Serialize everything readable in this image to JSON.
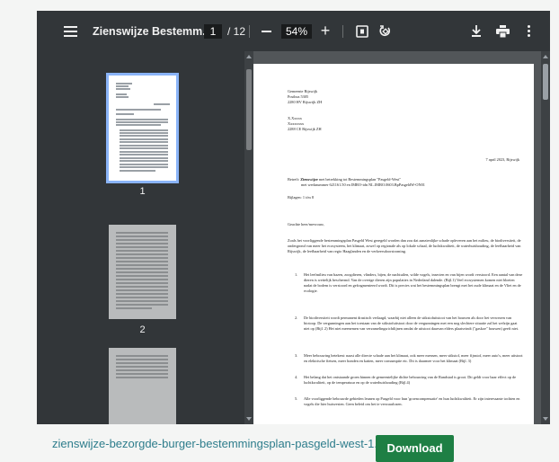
{
  "toolbar": {
    "title": "Zienswijze Bestemm...",
    "page_current": "1",
    "page_total": "/ 12",
    "zoom": "54%",
    "zoom_plus": "+"
  },
  "thumbnails": [
    {
      "number": "1"
    },
    {
      "number": "2"
    },
    {
      "number": ""
    }
  ],
  "document": {
    "address_1": "Gemeente Rijswijk",
    "address_2": "Postbus 5305",
    "address_3": "2280 HV Rijswijk ZH",
    "sender_1": "X.Xxxxx",
    "sender_2": "Xxxxxxxx",
    "sender_3": "2288 CE Rijswijk ZH",
    "date": "7 april 2023, Rijswijk",
    "subject_label": "Betreft:",
    "subject_bold": "Zienswijze",
    "subject_text": "met betrekking tot Bestemmingsplan \"Pasgeld-West\"",
    "subject_line2": "met werknummer 621161.50 en IMRO-idn NL.IMRO.0603.BpPasgeldW-ON01",
    "attachments": "Bijlagen: 1 t/m 8",
    "salutation": "Geachte heer/mevrouw,",
    "intro": "Zoals het voorliggende bestemmingsplan Pasgeld West geregeld worden dan zou dat aanzienlijke schade opleveren aan het milieu, de biodiversiteit, de ondergrond van meer het ecosysteem, het klimaat, zowel op regionale als op lokale schaal, de luchtkwaliteit, de waterhuishouding, de leefbaarheid van Rijswijk, de leefbaarheid van regio Haaglanden en de verkeersdoorstroming.",
    "item_1": "Het leefmilieu van bazen, zoogdieren, vlinders, bijen, de nachtuilen, wilde vogels, insecten en van bijen wordt verstoord. Een aantal van deze dieren is wettelijk beschermd. Van de overige dieren zijn populaties in Nederland dalende. (Bijl.1) Veel ecosystemen komen niet bloeien nadat de bodem is verstoord en gefragmenteerd wordt. Dit is precies wat het bestemmingsplan brengt met het oude klimaat en de Vliet en de ecologie.",
    "item_2": "De biodiversiteit wordt permanent drastisch verlaagd, waarbij niet alleen de stikstofuitstoot van het bouwen als door het verwezen van biotoop. De vergunningen aan het toestaan van de stikstofuitstoot door de vergunningen met een nog slechtere situatie zal het welzijn gaat niet op (Bijl. 2) Het niet meenemen van verzamelingsrichtlijnen omdat de uitstoot daarvan elders plaatsvindt (\"gaskoe\" houwen) geeft niet.",
    "item_3": "Meer bebouwing betekent: naast alle directe schade aan het klimaat, ook meer mensen, meer stikstof, meer fijnstof, meer auto's, meer uitstoot en elektrische fietsen, meer honden en katten, meer consumptie etc. Dit is daarmee voor het klimaat (Bijl. 3)",
    "item_4": "Het belang dat het ontstaande groen binnen de gemeentelijke dichte bebouwing van de Randstad is groot. Dit geldt voor haar effect op de luchtkwaliteit, op de temperatuur en op de waterhuishouding (Bijl.4)",
    "item_5": "Alle voorliggende bebouwde gebieden leunen op Pasgeld voor hun 'groencompensatie' en hun luchtkwaliteit. Er zijn interessante tochten en vogels die hier huisvesten. Geen beleid om het te verwaarlozen."
  },
  "footer": {
    "filename": "zienswijze-bezorgde-burger-bestemmingsplan-pasgeld-west-1.0",
    "download_label": "Download"
  }
}
